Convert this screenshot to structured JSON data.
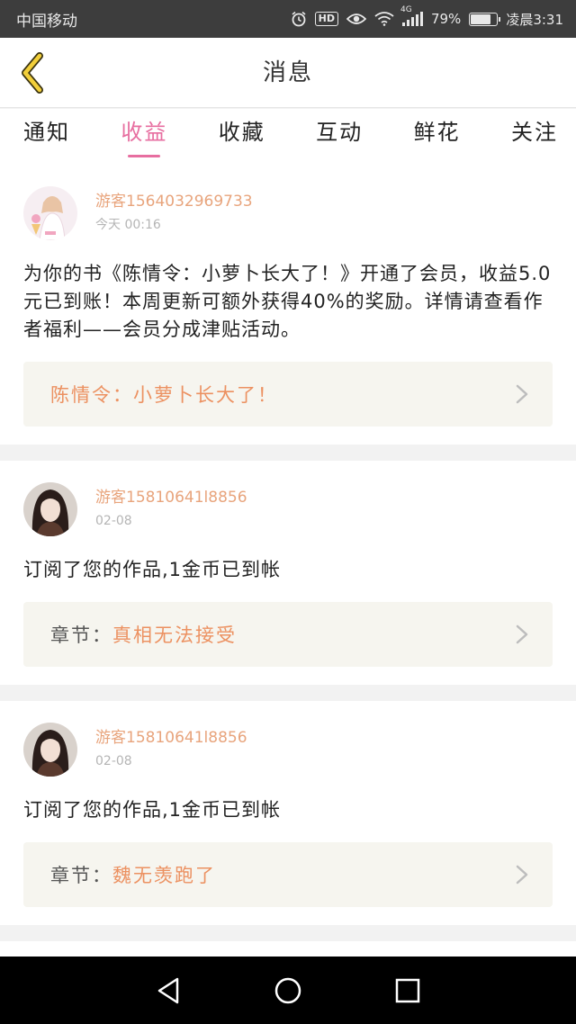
{
  "status_bar": {
    "carrier": "中国移动",
    "hd": "HD",
    "network": "4G",
    "battery": "79%",
    "battery_level": 0.79,
    "time": "凌晨3:31"
  },
  "header": {
    "title": "消息"
  },
  "tabs": [
    {
      "label": "通知",
      "active": false
    },
    {
      "label": "收益",
      "active": true
    },
    {
      "label": "收藏",
      "active": false
    },
    {
      "label": "互动",
      "active": false
    },
    {
      "label": "鲜花",
      "active": false
    },
    {
      "label": "关注",
      "active": false
    }
  ],
  "messages": [
    {
      "username": "游客1564032969733",
      "time": "今天 00:16",
      "text": "为你的书《陈情令：小萝卜长大了！》开通了会员，收益5.0元已到账！本周更新可额外获得40%的奖励。详情请查看作者福利——会员分成津贴活动。",
      "link_prefix": "",
      "link_title": "陈情令：小萝卜长大了！"
    },
    {
      "username": "游客15810641l8856",
      "time": "02-08",
      "text": "订阅了您的作品,1金币已到帐",
      "link_prefix": "章节：",
      "link_title": "真相无法接受"
    },
    {
      "username": "游客15810641l8856",
      "time": "02-08",
      "text": "订阅了您的作品,1金币已到帐",
      "link_prefix": "章节：",
      "link_title": "魏无羡跑了"
    }
  ],
  "colors": {
    "accent": "#e76ea0",
    "username": "#e8a47c",
    "link": "#ec9161",
    "link_bg": "#f6f5ef"
  },
  "icons": {
    "back": "chevron-left-icon",
    "nav_back": "triangle-back-icon",
    "nav_home": "circle-home-icon",
    "nav_recent": "square-recent-icon"
  }
}
